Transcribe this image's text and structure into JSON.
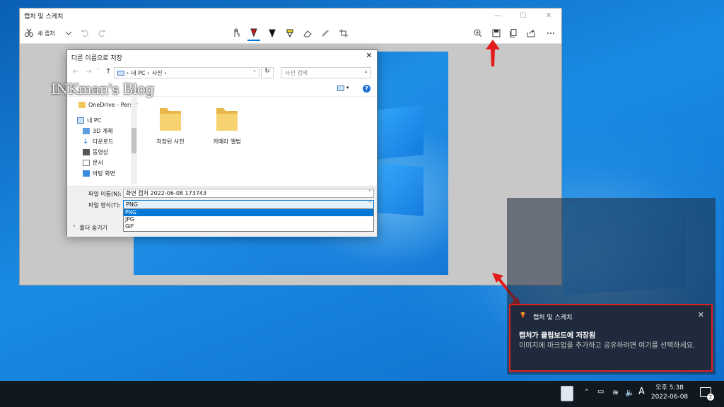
{
  "desktop": {
    "snip_window": {
      "title": "캡처 및 스케치",
      "controls": {
        "minimize": "—",
        "maximize": "☐",
        "close": "✕"
      },
      "toolbar": {
        "new_capture": "새 캡처"
      }
    },
    "save_dialog": {
      "title": "다른 이름으로 저장",
      "close": "✕",
      "address": {
        "root": "내 PC",
        "folder": "사진",
        "sep": "›"
      },
      "search_placeholder": "사진 검색",
      "sidebar": [
        {
          "label": "OneDrive - Person",
          "icon": "cloud-icon"
        },
        {
          "label": "내 PC",
          "icon": "pc-icon"
        },
        {
          "label": "3D 개체",
          "icon": "cube-icon"
        },
        {
          "label": "다운로드",
          "icon": "download-icon"
        },
        {
          "label": "동영상",
          "icon": "video-icon"
        },
        {
          "label": "문서",
          "icon": "document-icon"
        },
        {
          "label": "바탕 화면",
          "icon": "desktop-icon"
        }
      ],
      "folders": [
        {
          "label": "저장된 사진"
        },
        {
          "label": "카메라 앨범"
        }
      ],
      "file_name_label": "파일 이름(N):",
      "file_name_value": "화면 캡처 2022-06-08 173743",
      "file_type_label": "파일 형식(T):",
      "file_type_value": "PNG",
      "file_type_options": [
        "PNG",
        "JPG",
        "GIF"
      ],
      "hide_folders": "폴더 숨기기"
    },
    "watermark": "INKman's Blog"
  },
  "notification": {
    "app_name": "캡처 및 스케치",
    "close": "✕",
    "heading": "캡처가 클립보드에 저장됨",
    "body": "이미지에 마크업을 추가하고 공유하려면 여기를 선택하세요."
  },
  "taskbar": {
    "time": "오후 5:38",
    "date": "2022-06-08",
    "ime": "A",
    "notification_count": "2"
  },
  "colors": {
    "accent": "#0078d7",
    "highlight_border": "#e02020",
    "taskbar": "#101820"
  }
}
